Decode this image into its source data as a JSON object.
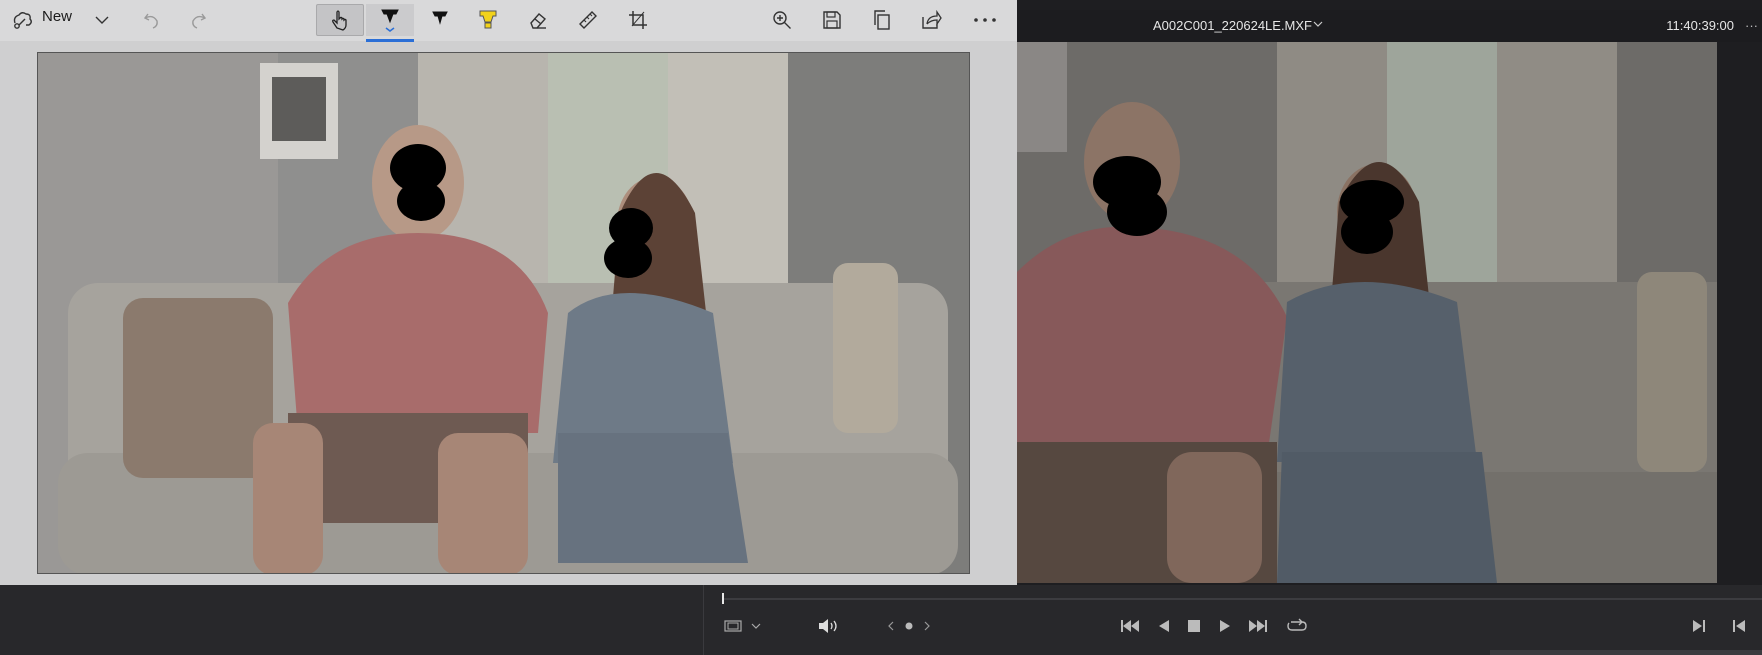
{
  "snip_toolbar": {
    "new_label": "New",
    "icons": [
      "snip-icon",
      "chevron-down-icon",
      "undo-icon",
      "redo-icon",
      "touch-writing-icon",
      "ballpoint-pen-icon",
      "pencil-icon",
      "highlighter-icon",
      "eraser-icon",
      "ruler-icon",
      "crop-icon",
      "zoom-in-icon",
      "save-icon",
      "copy-icon",
      "share-icon",
      "more-icon"
    ]
  },
  "viewer": {
    "clip_name": "A002C001_220624LE.MXF",
    "timecode": "11:40:39:00",
    "more_label": "···"
  },
  "playback": {
    "position": 0.0
  },
  "colors": {
    "toolbar_bg": "#d9d9da",
    "active_underline": "#2b6fd6",
    "resolve_bg": "#1e1e21",
    "transport_bg": "#28282b"
  }
}
